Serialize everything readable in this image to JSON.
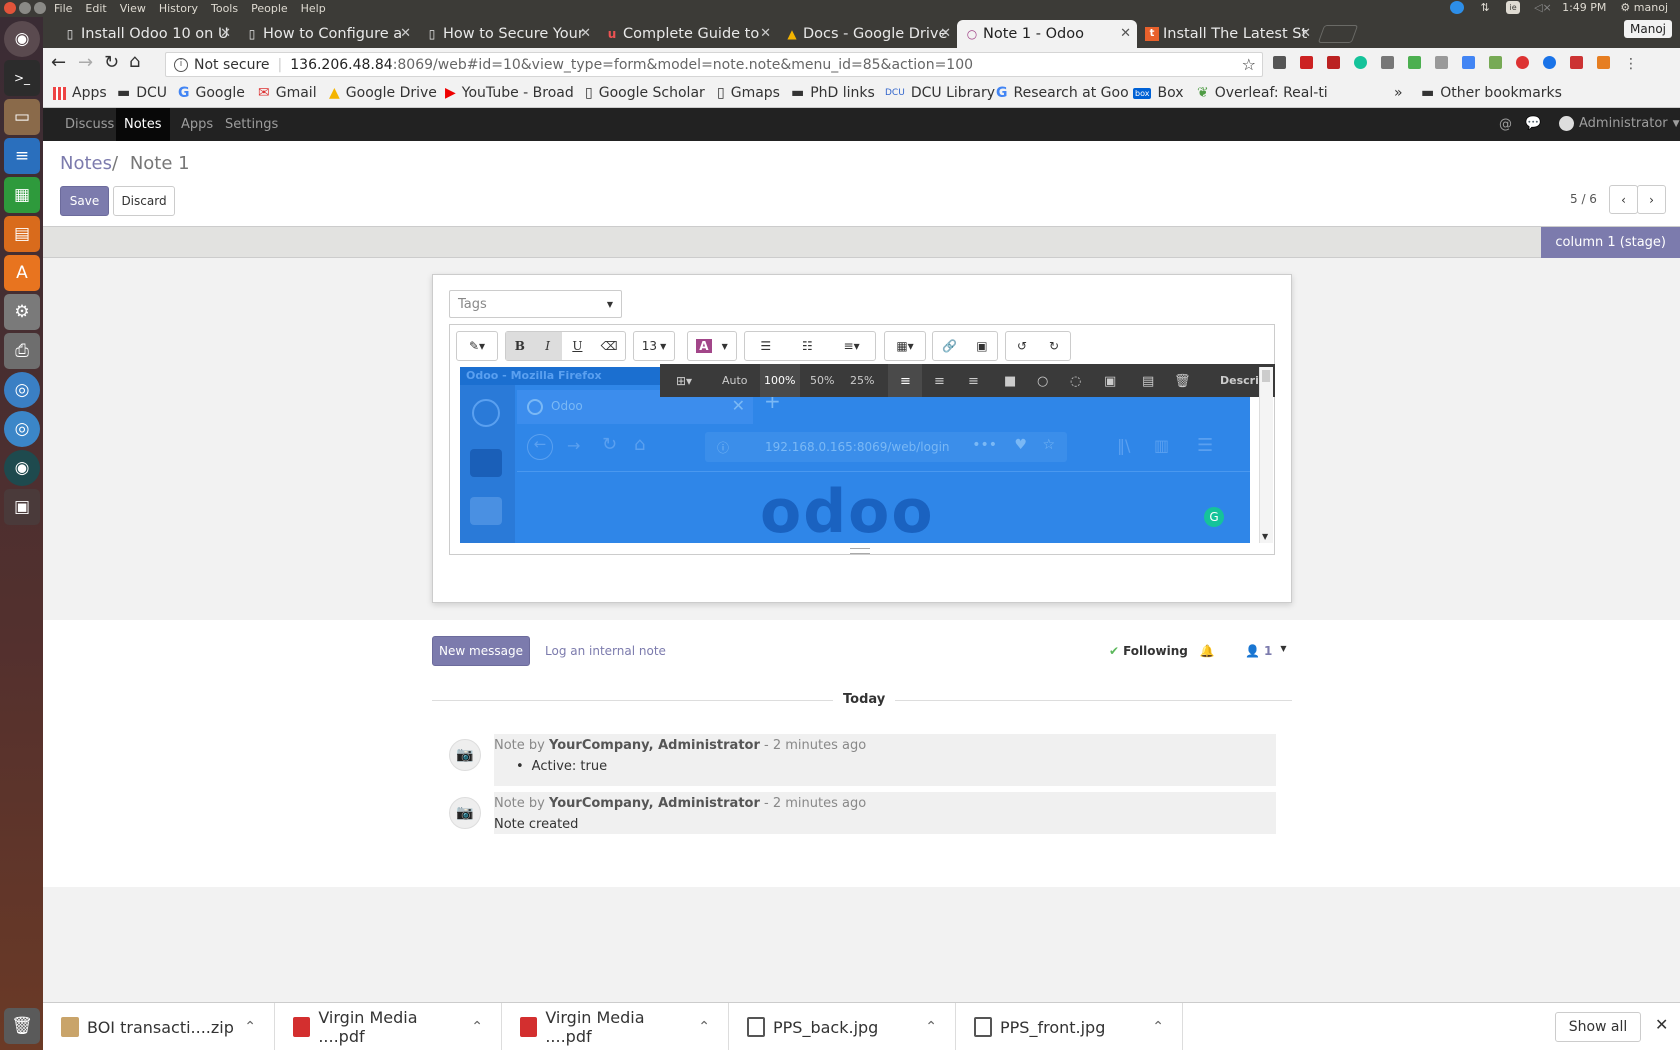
{
  "os": {
    "menu": [
      "File",
      "Edit",
      "View",
      "History",
      "Tools",
      "People",
      "Help"
    ],
    "clock": "1:49 PM",
    "user": "manoj",
    "profile_name": "Manoj",
    "colors": {
      "close": "#e2543a",
      "min": "#8a8a86",
      "max": "#8a8a86"
    }
  },
  "launcher_icons": [
    "ubuntu-dash-icon",
    "terminal-icon",
    "files-icon",
    "writer-icon",
    "calc-icon",
    "impress-icon",
    "software-center-icon",
    "settings-icon",
    "printer-icon",
    "chrome-icon",
    "chromium-icon",
    "system-monitor-icon",
    "workspaces-icon",
    "trash-icon"
  ],
  "tabs": [
    {
      "title": "Install Odoo 10 on U",
      "icon": "page-icon"
    },
    {
      "title": "How to Configure a",
      "icon": "page-icon"
    },
    {
      "title": "How to Secure Your",
      "icon": "page-icon"
    },
    {
      "title": "Complete Guide to",
      "icon": "udemy-icon"
    },
    {
      "title": "Docs - Google Drive",
      "icon": "drive-icon"
    },
    {
      "title": "Note 1 - Odoo",
      "icon": "odoo-icon"
    },
    {
      "title": "Install The Latest St",
      "icon": "t-icon"
    }
  ],
  "address": {
    "security": "Not secure",
    "host": "136.206.48.84",
    "rest": ":8069/web#id=10&view_type=form&model=note.note&menu_id=85&action=100"
  },
  "bookmarks": [
    {
      "label": "Apps",
      "icon": "apps-grid-icon"
    },
    {
      "label": "DCU",
      "icon": "folder-icon"
    },
    {
      "label": "Google",
      "icon": "google-icon"
    },
    {
      "label": "Gmail",
      "icon": "gmail-icon"
    },
    {
      "label": "Google Drive",
      "icon": "drive-icon"
    },
    {
      "label": "YouTube - Broad",
      "icon": "youtube-icon"
    },
    {
      "label": "Google Scholar",
      "icon": "page-icon"
    },
    {
      "label": "Gmaps",
      "icon": "page-icon"
    },
    {
      "label": "PhD links",
      "icon": "folder-icon"
    },
    {
      "label": "DCU Library",
      "icon": "dcu-icon"
    },
    {
      "label": "Research at Goo",
      "icon": "google-icon"
    },
    {
      "label": "Box",
      "icon": "box-icon"
    },
    {
      "label": "Overleaf: Real-ti",
      "icon": "overleaf-icon"
    }
  ],
  "other_bookmarks": "Other bookmarks",
  "odoo_nav": {
    "items": [
      "Discuss",
      "Notes",
      "Apps",
      "Settings"
    ],
    "active": "Notes",
    "user": "Administrator"
  },
  "breadcrumb": {
    "parent": "Notes",
    "separator": "/",
    "current": "Note 1"
  },
  "buttons": {
    "save": "Save",
    "discard": "Discard",
    "pager": "5 / 6"
  },
  "stage": "column 1 (stage)",
  "tags_placeholder": "Tags",
  "editor": {
    "font_size": "13",
    "image_toolbar": [
      "Auto",
      "100%",
      "50%",
      "25%"
    ],
    "image_toolbar_desc": "Descri",
    "embedded": {
      "window_title": "Odoo - Mozilla Firefox",
      "tab_title": "Odoo",
      "url": "192.168.0.165:8069/web/login",
      "logo": "odoo"
    }
  },
  "chatter": {
    "new_message": "New message",
    "log_note": "Log an internal note",
    "following": "Following",
    "followers": "1",
    "divider": "Today",
    "messages": [
      {
        "prefix": "Note by",
        "author": "YourCompany, Administrator",
        "time": "- 2 minutes ago",
        "body": "Active: true",
        "bullet": true
      },
      {
        "prefix": "Note by",
        "author": "YourCompany, Administrator",
        "time": "- 2 minutes ago",
        "body": "Note created",
        "bullet": false
      }
    ]
  },
  "downloads": [
    {
      "name": "BOI transacti....zip",
      "icon": "zip-icon"
    },
    {
      "name": "Virgin Media ....pdf",
      "icon": "pdf-icon"
    },
    {
      "name": "Virgin Media ....pdf",
      "icon": "pdf-icon"
    },
    {
      "name": "PPS_back.jpg",
      "icon": "image-file-icon"
    },
    {
      "name": "PPS_front.jpg",
      "icon": "image-file-icon"
    }
  ],
  "show_all": "Show all",
  "accent": "#7c7bad"
}
